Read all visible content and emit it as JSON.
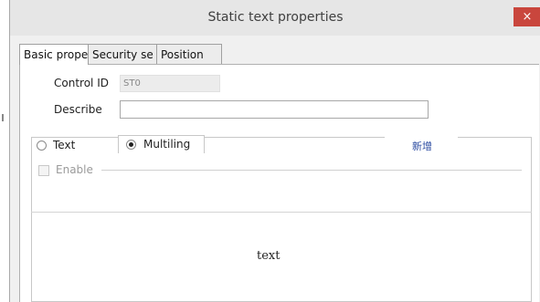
{
  "window": {
    "title": "Static text properties",
    "close_glyph": "×"
  },
  "tabs": [
    {
      "label": "Basic prope",
      "active": true
    },
    {
      "label": "Security se",
      "active": false
    },
    {
      "label": "Position",
      "active": false
    }
  ],
  "form": {
    "control_id_label": "Control ID",
    "control_id_value": "ST0",
    "describe_label": "Describe",
    "describe_value": ""
  },
  "text_mode": {
    "option_text": "Text",
    "option_multilingual": "Multiling",
    "selected": "Multiling",
    "add_link": "新增"
  },
  "enable": {
    "label": "Enable",
    "checked": false
  },
  "preview": {
    "text": "text"
  }
}
